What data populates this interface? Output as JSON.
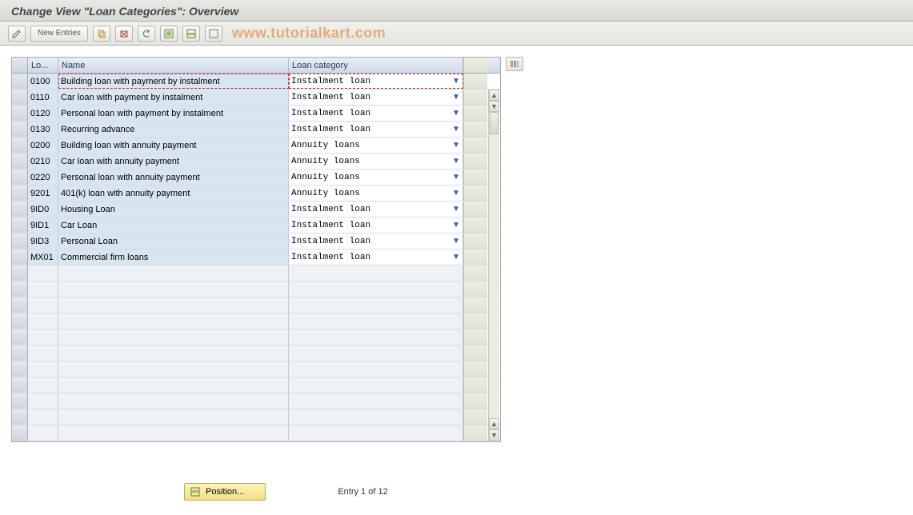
{
  "header": {
    "title": "Change View \"Loan Categories\": Overview"
  },
  "toolbar": {
    "new_entries_label": "New Entries"
  },
  "watermark": "www.tutorialkart.com",
  "table": {
    "columns": {
      "code": "Lo...",
      "name": "Name",
      "category": "Loan category"
    },
    "rows": [
      {
        "code": "0100",
        "name": "Building loan with payment by instalment",
        "category": "Instalment loan"
      },
      {
        "code": "0110",
        "name": "Car loan with payment by instalment",
        "category": "Instalment loan"
      },
      {
        "code": "0120",
        "name": "Personal loan with payment by instalment",
        "category": "Instalment loan"
      },
      {
        "code": "0130",
        "name": "Recurring advance",
        "category": "Instalment loan"
      },
      {
        "code": "0200",
        "name": "Building loan with annuity payment",
        "category": "Annuity loans"
      },
      {
        "code": "0210",
        "name": "Car loan with annuity payment",
        "category": "Annuity loans"
      },
      {
        "code": "0220",
        "name": "Personal loan with annuity payment",
        "category": "Annuity loans"
      },
      {
        "code": "9201",
        "name": "401(k) loan with annuity payment",
        "category": "Annuity loans"
      },
      {
        "code": "9ID0",
        "name": "Housing Loan",
        "category": "Instalment loan"
      },
      {
        "code": "9ID1",
        "name": "Car Loan",
        "category": "Instalment loan"
      },
      {
        "code": "9ID3",
        "name": "Personal Loan",
        "category": "Instalment loan"
      },
      {
        "code": "MX01",
        "name": "Commercial firm loans",
        "category": "Instalment loan"
      }
    ],
    "empty_row_count": 11
  },
  "footer": {
    "position_label": "Position...",
    "entry_label": "Entry 1 of 12"
  }
}
